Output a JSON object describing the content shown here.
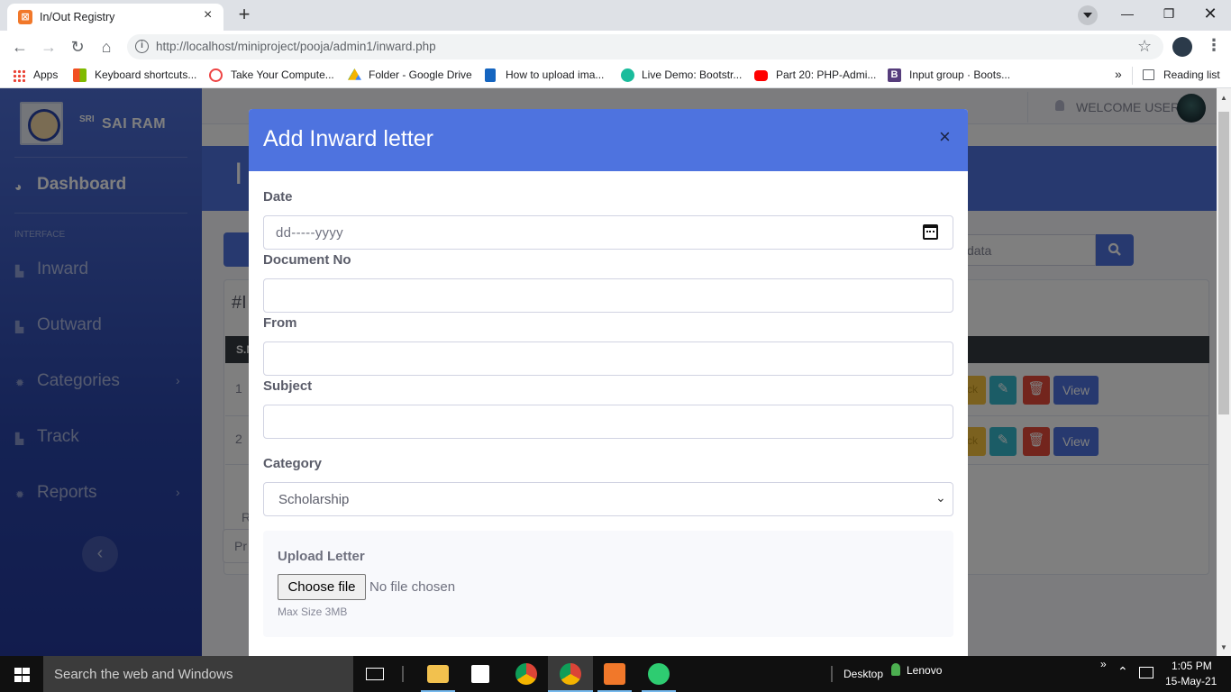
{
  "browser": {
    "tab_title": "In/Out Registry",
    "tab_icon_glyph": "⊠",
    "url": "http://localhost/miniproject/pooja/admin1/inward.php",
    "bookmarks": [
      {
        "label": "Apps",
        "icon": "apps-grid-icon"
      },
      {
        "label": "Keyboard shortcuts...",
        "icon": "microsoft-icon"
      },
      {
        "label": "Take Your Compute...",
        "icon": "site-icon"
      },
      {
        "label": "Folder - Google Drive",
        "icon": "google-drive-icon"
      },
      {
        "label": "How to upload ima...",
        "icon": "site-icon"
      },
      {
        "label": "Live Demo: Bootstr...",
        "icon": "site-icon"
      },
      {
        "label": "Part 20: PHP-Admi...",
        "icon": "youtube-icon"
      },
      {
        "label": "Input group · Boots...",
        "icon": "bootstrap-icon"
      }
    ],
    "more_bookmarks": "»",
    "reading_list": "Reading list"
  },
  "sidebar": {
    "brand_prefix": "SRI",
    "brand": "SAI RAM",
    "dashboard": "Dashboard",
    "section_heading": "INTERFACE",
    "items": [
      {
        "label": "Inward",
        "icon": "chart-icon"
      },
      {
        "label": "Outward",
        "icon": "chart-icon"
      },
      {
        "label": "Categories",
        "icon": "gear-icon",
        "has_submenu": true
      },
      {
        "label": "Track",
        "icon": "chart-icon"
      },
      {
        "label": "Reports",
        "icon": "gear-icon",
        "has_submenu": true
      }
    ],
    "toggle_glyph": "‹"
  },
  "topbar": {
    "welcome": "WELCOME USER"
  },
  "background_page": {
    "hero_title_partial": "I",
    "search_placeholder_partial": "data",
    "card_title_partial": "#I",
    "table_header_partial": "S.N",
    "rows": [
      {
        "n": "1",
        "view_label": "View",
        "partial_label": "ck"
      },
      {
        "n": "2",
        "view_label": "View",
        "partial_label": "ck"
      }
    ],
    "pager_label_partial": "R",
    "pager_prev_partial": "Pr"
  },
  "modal": {
    "title": "Add Inward letter",
    "close_glyph": "×",
    "fields": {
      "date_label": "Date",
      "date_placeholder": "dd-----yyyy",
      "docno_label": "Document No",
      "docno_value": "",
      "from_label": "From",
      "from_value": "",
      "subject_label": "Subject",
      "subject_value": "",
      "category_label": "Category",
      "category_value": "Scholarship"
    },
    "upload": {
      "label": "Upload Letter",
      "button": "Choose file",
      "status": "No file chosen",
      "hint": "Max Size 3MB"
    }
  },
  "taskbar": {
    "search_text": "Search the web and Windows",
    "desktop": "Desktop",
    "user": "Lenovo",
    "time": "1:05 PM",
    "date": "15-May-21",
    "tray_chevron": "»"
  },
  "colors": {
    "primary": "#4e73df",
    "sidebar_top": "#4e6fd6",
    "sidebar_bottom": "#24399b",
    "warning": "#f6c23e",
    "info": "#36b9cc",
    "danger": "#e74a3b"
  }
}
